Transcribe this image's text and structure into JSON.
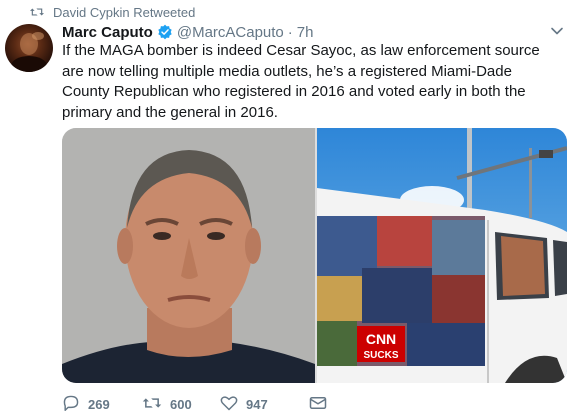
{
  "retweet_banner": {
    "icon": "retweet-icon",
    "text": "David Cypkin Retweeted"
  },
  "author": {
    "display_name": "Marc Caputo",
    "verified_icon": "verified-badge-icon",
    "handle": "@MarcACaputo",
    "separator": "·",
    "time": "7h"
  },
  "tweet": {
    "text": "If the MAGA bomber is indeed Cesar Sayoc, as law enforcement source are now telling multiple media outlets, he’s a registered Miami-Dade County Republican who registered in 2016 and voted early in both the primary and the general in 2016."
  },
  "media": {
    "left_image": "mugshot-photo",
    "right_image": "van-photo",
    "van_decal_texts": [
      "CNN",
      "SUCKS"
    ]
  },
  "actions": {
    "reply_count": "269",
    "retweet_count": "600",
    "like_count": "947"
  },
  "colors": {
    "muted": "#657786",
    "verified": "#1da1f2",
    "text": "#14171a"
  }
}
